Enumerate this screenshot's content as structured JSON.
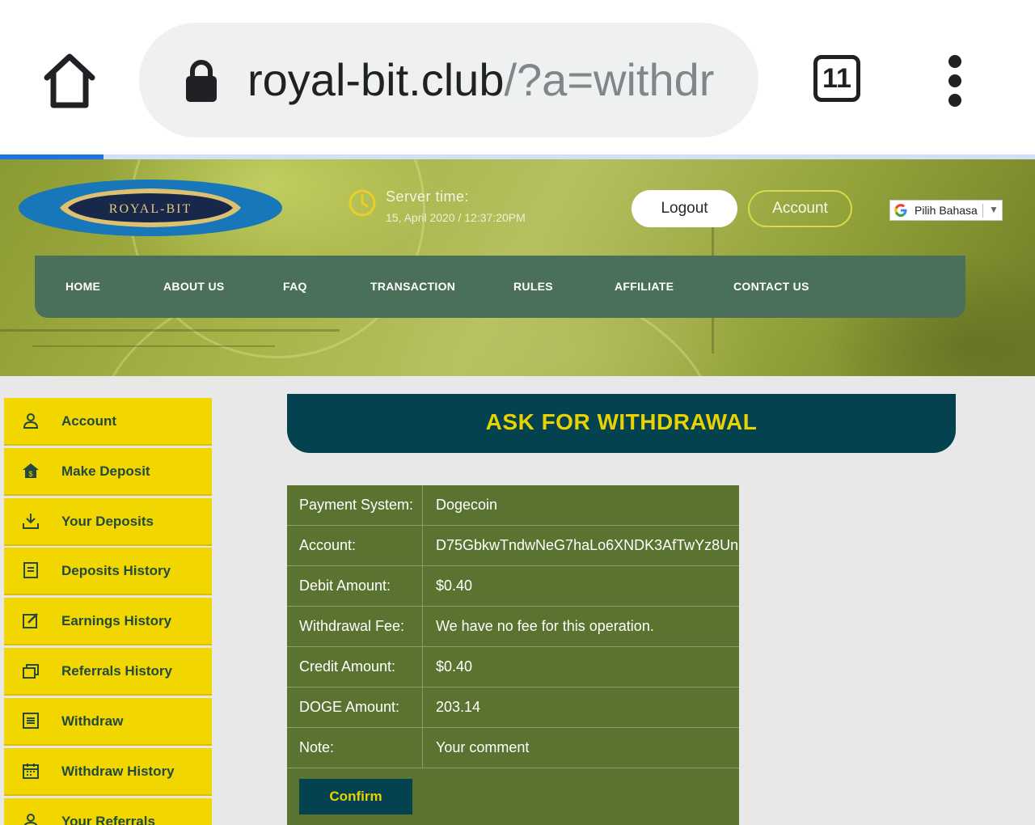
{
  "browser": {
    "url_host": "royal-bit.club",
    "url_path": "/?a=withdr",
    "tab_count": "11",
    "load_progress": 0.1
  },
  "header": {
    "logo_text": "ROYAL-BIT",
    "server_time_label": "Server time:",
    "server_time_value": "15, April 2020 / 12:37:20PM",
    "logout_label": "Logout",
    "account_label": "Account",
    "language_label": "Pilih Bahasa",
    "language_arrow": "▼"
  },
  "nav": {
    "items": [
      {
        "label": "HOME"
      },
      {
        "label": "ABOUT US"
      },
      {
        "label": "FAQ"
      },
      {
        "label": "TRANSACTION"
      },
      {
        "label": "RULES"
      },
      {
        "label": "AFFILIATE"
      },
      {
        "label": "CONTACT US"
      }
    ]
  },
  "sidebar": {
    "items": [
      {
        "label": "Account",
        "icon": "user-icon"
      },
      {
        "label": "Make Deposit",
        "icon": "home-dollar-icon"
      },
      {
        "label": "Your Deposits",
        "icon": "download-tray-icon"
      },
      {
        "label": "Deposits History",
        "icon": "document-icon"
      },
      {
        "label": "Earnings History",
        "icon": "edit-icon"
      },
      {
        "label": "Referrals History",
        "icon": "stack-icon"
      },
      {
        "label": "Withdraw",
        "icon": "list-icon"
      },
      {
        "label": "Withdraw History",
        "icon": "calendar-icon"
      },
      {
        "label": "Your Referrals",
        "icon": "users-icon"
      }
    ]
  },
  "main": {
    "title": "ASK FOR WITHDRAWAL",
    "form": {
      "rows": [
        {
          "label": "Payment System:",
          "value": "Dogecoin"
        },
        {
          "label": "Account:",
          "value": "D75GbkwTndwNeG7haLo6XNDK3AfTwYz8Un"
        },
        {
          "label": "Debit Amount:",
          "value": "$0.40"
        },
        {
          "label": "Withdrawal Fee:",
          "value": "We have no fee for this operation."
        },
        {
          "label": "Credit Amount:",
          "value": "$0.40"
        },
        {
          "label": "DOGE Amount:",
          "value": "203.14"
        },
        {
          "label": "Note:",
          "value": "Your comment"
        }
      ],
      "confirm_label": "Confirm"
    }
  },
  "colors": {
    "nav_bg": "#4b705a",
    "sidebar_bg": "#f2d600",
    "title_bar_bg": "#044250",
    "title_text": "#e8d200",
    "form_bg": "#5a7330"
  }
}
